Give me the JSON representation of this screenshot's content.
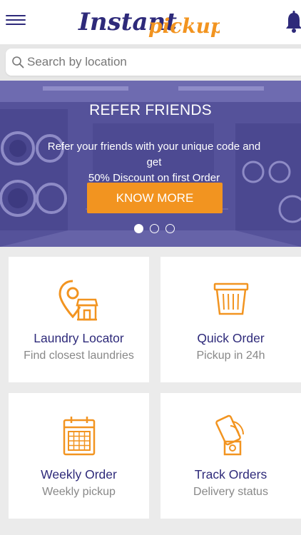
{
  "header": {
    "logo_part1": "Instant",
    "logo_part2": "pickup",
    "menu_icon": "hamburger-menu-icon",
    "notification_icon": "bell-icon"
  },
  "search": {
    "placeholder": "Search by location",
    "icon": "search-icon"
  },
  "banner": {
    "title": "REFER FRIENDS",
    "text_line1": "Refer your friends with your unique code and get",
    "text_line2": "50% Discount on first Order",
    "button_label": "KNOW MORE",
    "slides": 3,
    "active_slide": 1
  },
  "cards": [
    {
      "title": "Laundry Locator",
      "subtitle": "Find closest laundries",
      "icon": "location-store-icon"
    },
    {
      "title": "Quick Order",
      "subtitle": "Pickup in 24h",
      "icon": "basket-icon"
    },
    {
      "title": "Weekly Order",
      "subtitle": "Weekly pickup",
      "icon": "calendar-icon"
    },
    {
      "title": "Track Orders",
      "subtitle": "Delivery status",
      "icon": "phone-tracking-icon"
    }
  ],
  "colors": {
    "brand_purple": "#2e2a7a",
    "brand_orange": "#f29420",
    "banner_overlay": "#4a4790",
    "background": "#ebebeb"
  }
}
